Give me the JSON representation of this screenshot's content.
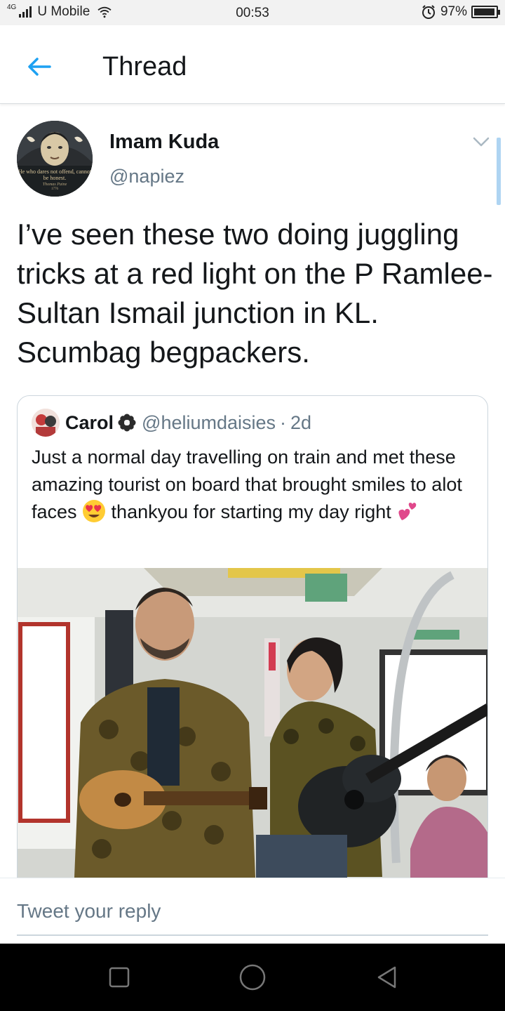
{
  "status_bar": {
    "network": "4G",
    "carrier": "U Mobile",
    "time": "00:53",
    "battery": "97%",
    "battery_level": 0.97,
    "icons": [
      "signal-icon",
      "wifi-icon",
      "alarm-icon",
      "battery-icon"
    ]
  },
  "header": {
    "title": "Thread",
    "back_icon": "arrow-left-icon"
  },
  "tweet": {
    "author_name": "Imam Kuda",
    "author_handle": "@napiez",
    "avatar_caption": "He who dares not offend, cannot be honest.",
    "avatar_signature": "Thomas Paine",
    "avatar_year": "1776",
    "text": "I’ve seen these two doing juggling tricks at a red light on the P Ramlee-Sultan Ismail junction in KL. Scumbag begpackers."
  },
  "quoted_tweet": {
    "author_name": "Carol",
    "author_handle": "@heliumdaisies",
    "separator": "·",
    "time": "2d",
    "text_part1": "Just a normal day travelling on train and met these amazing tourist on board that brought smiles to alot faces ",
    "text_part2": " thankyou for starting my day right ",
    "emojis": [
      "heart-eyes-emoji",
      "two-hearts-emoji"
    ]
  },
  "reply": {
    "placeholder": "Tweet your reply"
  },
  "nav_bar": {
    "icons": [
      "recents-icon",
      "home-icon",
      "back-icon"
    ]
  },
  "colors": {
    "accent": "#1da1f2",
    "text_primary": "#14171a",
    "text_secondary": "#657786",
    "border": "#ccd6dd"
  }
}
